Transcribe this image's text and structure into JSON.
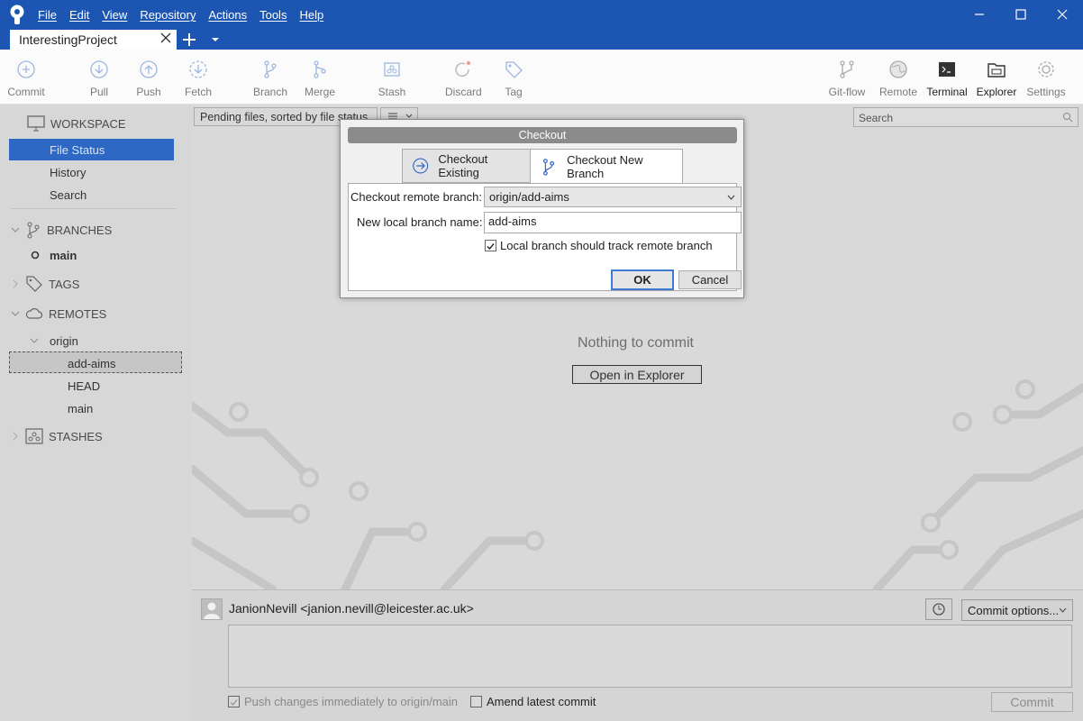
{
  "menu": [
    "File",
    "Edit",
    "View",
    "Repository",
    "Actions",
    "Tools",
    "Help"
  ],
  "repo_tab": "InterestingProject",
  "toolbar": {
    "commit": "Commit",
    "pull": "Pull",
    "push": "Push",
    "fetch": "Fetch",
    "branch": "Branch",
    "merge": "Merge",
    "stash": "Stash",
    "discard": "Discard",
    "tag": "Tag",
    "gitflow": "Git-flow",
    "remote": "Remote",
    "terminal": "Terminal",
    "explorer": "Explorer",
    "settings": "Settings"
  },
  "sidebar": {
    "workspace": "WORKSPACE",
    "file_status": "File Status",
    "history": "History",
    "search": "Search",
    "branches": "BRANCHES",
    "branch_main": "main",
    "tags": "TAGS",
    "remotes": "REMOTES",
    "origin": "origin",
    "remote_branches": [
      "add-aims",
      "HEAD",
      "main"
    ],
    "stashes": "STASHES"
  },
  "main": {
    "filter": "Pending files, sorted by file status",
    "search_placeholder": "Search",
    "empty_text": "Nothing to commit",
    "open_explorer": "Open in Explorer"
  },
  "commit": {
    "author": "JanionNevill <janion.nevill@leicester.ac.uk>",
    "options": "Commit options...",
    "push_label": "Push changes immediately to origin/main",
    "amend_label": "Amend latest commit",
    "commit_button": "Commit"
  },
  "dialog": {
    "title": "Checkout",
    "tab_existing": "Checkout Existing",
    "tab_new": "Checkout New Branch",
    "remote_label": "Checkout remote branch:",
    "remote_value": "origin/add-aims",
    "local_label": "New local branch name:",
    "local_value": "add-aims",
    "track_label": "Local branch should track remote branch",
    "ok": "OK",
    "cancel": "Cancel"
  },
  "colors": {
    "titlebar": "#1d55b3",
    "selection": "#2d68c4",
    "ok_border": "#3d7bd4"
  }
}
